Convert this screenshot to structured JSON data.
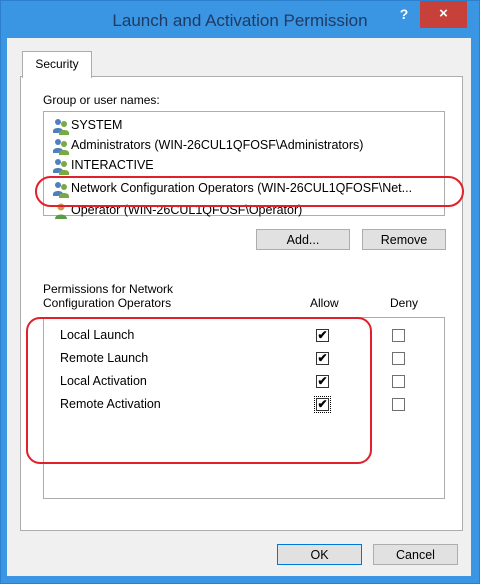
{
  "dialog": {
    "title": "Launch and Activation Permission",
    "help_label": "?",
    "close_label": "×"
  },
  "tabs": [
    {
      "label": "Security",
      "selected": true
    }
  ],
  "group_label": "Group or user names:",
  "users": [
    {
      "name": "SYSTEM",
      "icon": "user-group-icon"
    },
    {
      "name": "Administrators (WIN-26CUL1QFOSF\\Administrators)",
      "icon": "user-group-icon"
    },
    {
      "name": "INTERACTIVE",
      "icon": "user-group-icon"
    },
    {
      "name": "Network Configuration Operators (WIN-26CUL1QFOSF\\Net...",
      "icon": "user-group-icon",
      "selected": true
    },
    {
      "name": "Operator (WIN-26CUL1QFOSF\\Operator)",
      "icon": "single-user-icon"
    }
  ],
  "buttons": {
    "add": "Add...",
    "remove": "Remove",
    "ok": "OK",
    "cancel": "Cancel"
  },
  "permissions_label_line1": "Permissions for Network",
  "permissions_label_line2": "Configuration Operators",
  "columns": {
    "allow": "Allow",
    "deny": "Deny"
  },
  "permissions": [
    {
      "name": "Local Launch",
      "allow": true,
      "deny": false
    },
    {
      "name": "Remote Launch",
      "allow": true,
      "deny": false
    },
    {
      "name": "Local Activation",
      "allow": true,
      "deny": false
    },
    {
      "name": "Remote Activation",
      "allow": true,
      "deny": false
    }
  ],
  "check_glyph": "✔",
  "colors": {
    "title_bar": "#3a95e2",
    "close_button": "#c7403a",
    "annotation": "#e0202a"
  }
}
